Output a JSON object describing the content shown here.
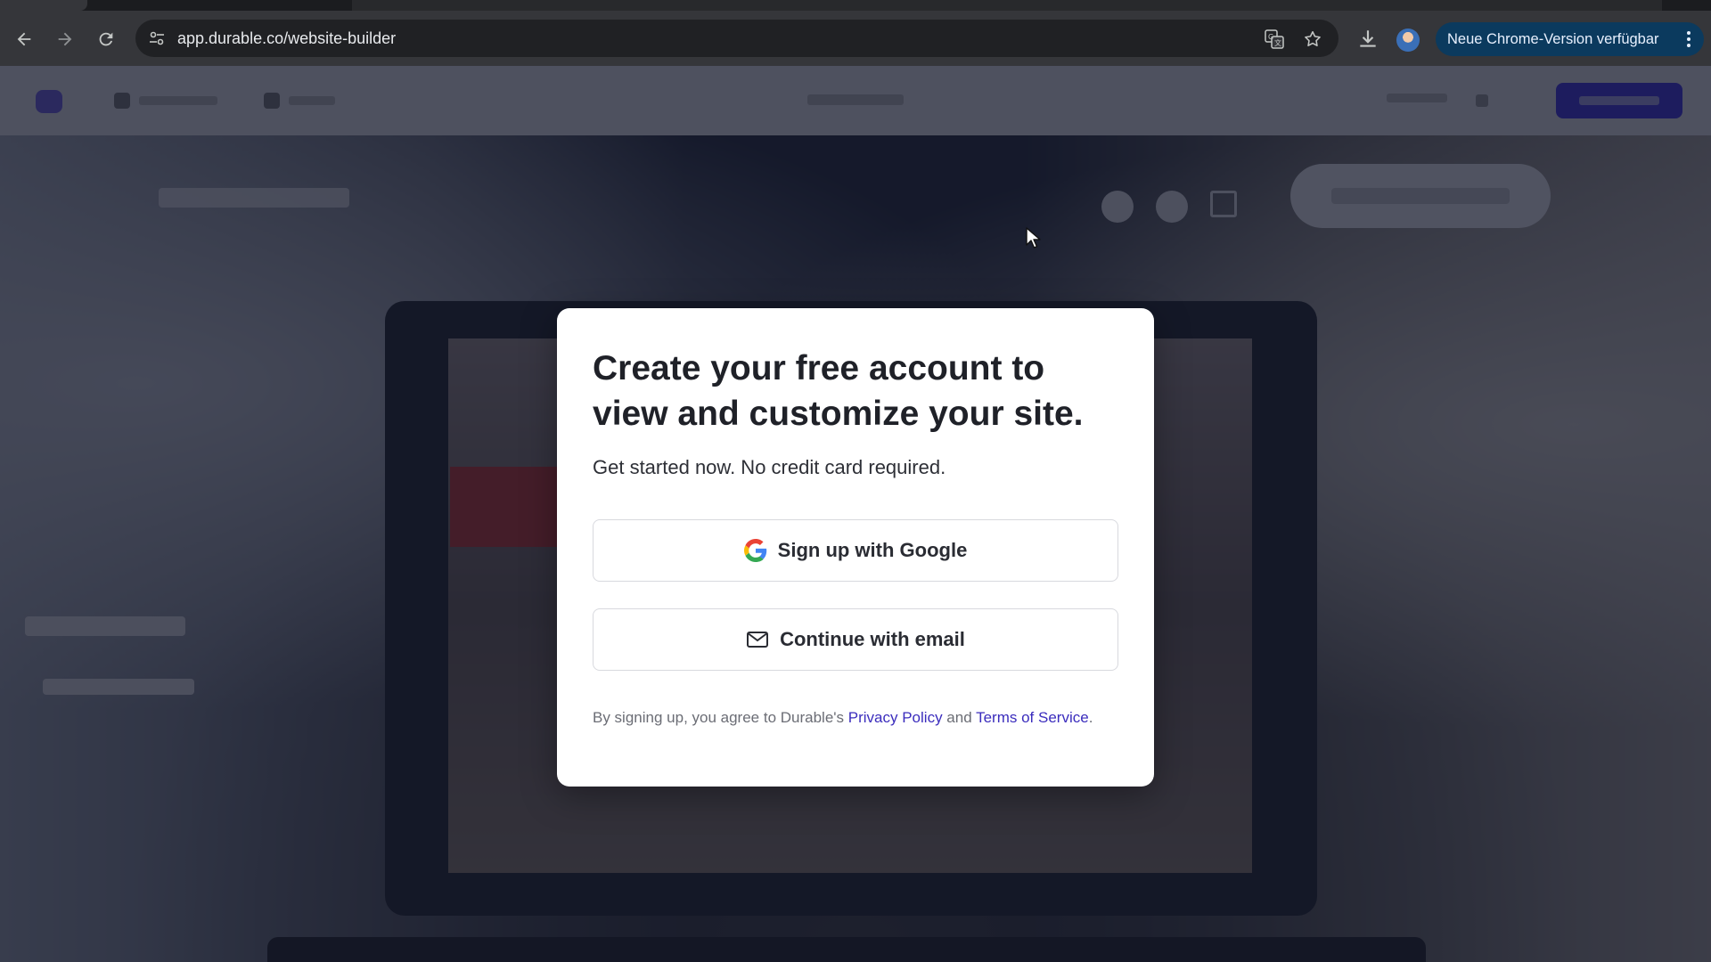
{
  "browser": {
    "url": "app.durable.co/website-builder",
    "update_chip_label": "Neue Chrome-Version verfügbar"
  },
  "modal": {
    "title": "Create your free account to view and customize your site.",
    "subtitle": "Get started now. No credit card required.",
    "google_button_label": "Sign up with Google",
    "email_button_label": "Continue with email",
    "legal_prefix": "By signing up, you agree to Durable's ",
    "privacy_link": "Privacy Policy",
    "legal_and": " and ",
    "terms_link": "Terms of Service",
    "legal_suffix": "."
  },
  "colors": {
    "publish_button": "#3b2ee8",
    "link": "#3b2dbd",
    "update_chip": "#0b3a5e"
  },
  "icons": [
    "back-arrow-icon",
    "forward-arrow-icon",
    "reload-icon",
    "site-info-icon",
    "translate-icon",
    "bookmark-star-icon",
    "download-icon",
    "profile-avatar",
    "more-vert-icon",
    "google-g-icon",
    "mail-icon",
    "cursor-pointer-icon"
  ]
}
